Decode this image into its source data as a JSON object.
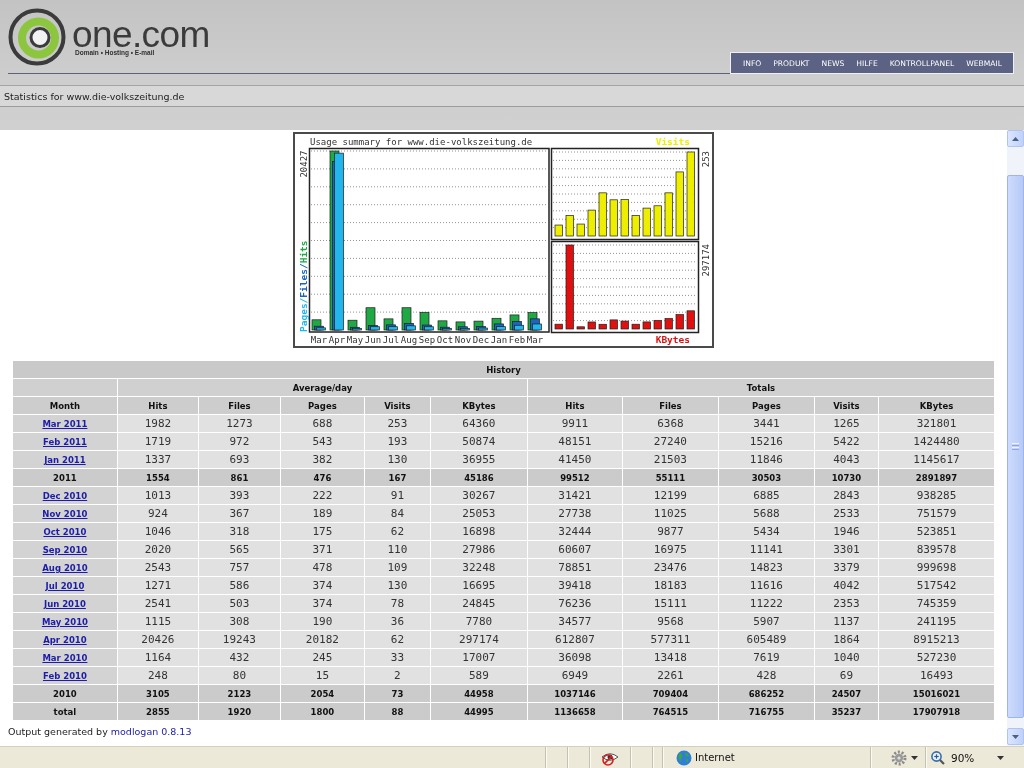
{
  "header": {
    "logo": {
      "wordmark": "one.com",
      "tagline": "Domain • Hosting • E-mail"
    },
    "nav": [
      {
        "label": "INFO"
      },
      {
        "label": "PRODUKT"
      },
      {
        "label": "NEWS"
      },
      {
        "label": "HILFE"
      },
      {
        "label": "KONTROLLPANEL"
      },
      {
        "label": "WEBMAIL"
      }
    ]
  },
  "page_title": "Statistics for www.die-volkszeitung.de",
  "usage_chart": {
    "title": "Usage summary for www.die-volkszeitung.de",
    "main_panel": {
      "max_label": "20427",
      "y_label": [
        {
          "kind": "pages",
          "text": "Pages/",
          "color": "#22b6ee"
        },
        {
          "kind": "files",
          "text": "Files/",
          "color": "#1c64c0"
        },
        {
          "kind": "hits",
          "text": "Hits",
          "color": "#1fa843"
        }
      ],
      "months": [
        "Mar",
        "Apr",
        "May",
        "Jun",
        "Jul",
        "Aug",
        "Sep",
        "Oct",
        "Nov",
        "Dec",
        "Jan",
        "Feb",
        "Mar"
      ]
    },
    "side_panels": [
      {
        "kind": "visits",
        "label": "Visits",
        "max_label": "253",
        "color": "#eeee00"
      },
      {
        "kind": "kbytes",
        "label": "KBytes",
        "max_label": "297174",
        "color": "#e01010"
      }
    ]
  },
  "history": {
    "title": "History",
    "groups": [
      {
        "label": "Average/day"
      },
      {
        "label": "Totals"
      }
    ],
    "columns": [
      "Month",
      "Hits",
      "Files",
      "Pages",
      "Visits",
      "KBytes",
      "Hits",
      "Files",
      "Pages",
      "Visits",
      "KBytes"
    ],
    "rows": [
      {
        "kind": "month",
        "cells": [
          "Mar 2011",
          "1982",
          "1273",
          "688",
          "253",
          "64360",
          "9911",
          "6368",
          "3441",
          "1265",
          "321801"
        ]
      },
      {
        "kind": "month",
        "cells": [
          "Feb 2011",
          "1719",
          "972",
          "543",
          "193",
          "50874",
          "48151",
          "27240",
          "15216",
          "5422",
          "1424480"
        ]
      },
      {
        "kind": "month",
        "cells": [
          "Jan 2011",
          "1337",
          "693",
          "382",
          "130",
          "36955",
          "41450",
          "21503",
          "11846",
          "4043",
          "1145617"
        ]
      },
      {
        "kind": "summary",
        "cells": [
          "2011",
          "1554",
          "861",
          "476",
          "167",
          "45186",
          "99512",
          "55111",
          "30503",
          "10730",
          "2891897"
        ]
      },
      {
        "kind": "month",
        "cells": [
          "Dec 2010",
          "1013",
          "393",
          "222",
          "91",
          "30267",
          "31421",
          "12199",
          "6885",
          "2843",
          "938285"
        ]
      },
      {
        "kind": "month",
        "cells": [
          "Nov 2010",
          "924",
          "367",
          "189",
          "84",
          "25053",
          "27738",
          "11025",
          "5688",
          "2533",
          "751579"
        ]
      },
      {
        "kind": "month",
        "cells": [
          "Oct 2010",
          "1046",
          "318",
          "175",
          "62",
          "16898",
          "32444",
          "9877",
          "5434",
          "1946",
          "523851"
        ]
      },
      {
        "kind": "month",
        "cells": [
          "Sep 2010",
          "2020",
          "565",
          "371",
          "110",
          "27986",
          "60607",
          "16975",
          "11141",
          "3301",
          "839578"
        ]
      },
      {
        "kind": "month",
        "cells": [
          "Aug 2010",
          "2543",
          "757",
          "478",
          "109",
          "32248",
          "78851",
          "23476",
          "14823",
          "3379",
          "999698"
        ]
      },
      {
        "kind": "month",
        "cells": [
          "Jul 2010",
          "1271",
          "586",
          "374",
          "130",
          "16695",
          "39418",
          "18183",
          "11616",
          "4042",
          "517542"
        ]
      },
      {
        "kind": "month",
        "cells": [
          "Jun 2010",
          "2541",
          "503",
          "374",
          "78",
          "24845",
          "76236",
          "15111",
          "11222",
          "2353",
          "745359"
        ]
      },
      {
        "kind": "month",
        "cells": [
          "May 2010",
          "1115",
          "308",
          "190",
          "36",
          "7780",
          "34577",
          "9568",
          "5907",
          "1137",
          "241195"
        ]
      },
      {
        "kind": "month",
        "cells": [
          "Apr 2010",
          "20426",
          "19243",
          "20182",
          "62",
          "297174",
          "612807",
          "577311",
          "605489",
          "1864",
          "8915213"
        ]
      },
      {
        "kind": "month",
        "cells": [
          "Mar 2010",
          "1164",
          "432",
          "245",
          "33",
          "17007",
          "36098",
          "13418",
          "7619",
          "1040",
          "527230"
        ]
      },
      {
        "kind": "month",
        "cells": [
          "Feb 2010",
          "248",
          "80",
          "15",
          "2",
          "589",
          "6949",
          "2261",
          "428",
          "69",
          "16493"
        ]
      },
      {
        "kind": "summary",
        "cells": [
          "2010",
          "3105",
          "2123",
          "2054",
          "73",
          "44958",
          "1037146",
          "709404",
          "686252",
          "24507",
          "15016021"
        ]
      },
      {
        "kind": "summary",
        "cells": [
          "total",
          "2855",
          "1920",
          "1800",
          "88",
          "44995",
          "1136658",
          "764515",
          "716755",
          "35237",
          "17907918"
        ]
      }
    ]
  },
  "footer": {
    "text": "Output generated by",
    "link": "modlogan 0.8.13"
  },
  "status_bar": {
    "zone": "Internet",
    "zoom": "90%"
  }
}
